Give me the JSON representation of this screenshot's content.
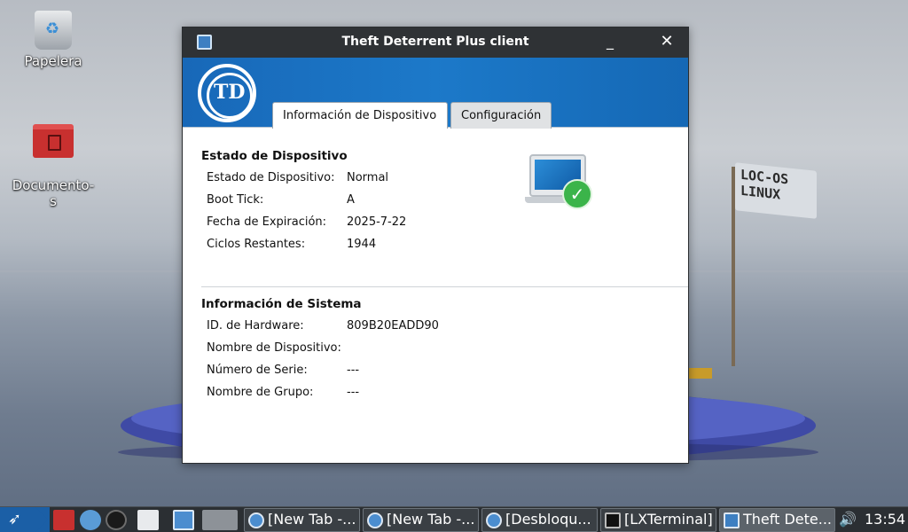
{
  "desktop": {
    "icons": [
      {
        "label": "Papelera",
        "icon": "trash-icon"
      },
      {
        "label": "Documento-\ns",
        "icon": "folder-icon"
      }
    ],
    "flag_text": [
      "LOC-OS",
      "LINUX"
    ]
  },
  "window": {
    "title": "Theft Deterrent Plus client",
    "minimize_glyph": "_",
    "close_glyph": "✕",
    "logo_text": "TD",
    "tabs": [
      {
        "label": "Información de Dispositivo",
        "active": true
      },
      {
        "label": "Configuración",
        "active": false
      }
    ],
    "device_status": {
      "heading": "Estado de Dispositivo",
      "rows": [
        {
          "label": "Estado de Dispositivo:",
          "value": "Normal"
        },
        {
          "label": "Boot Tick:",
          "value": "A"
        },
        {
          "label": "Fecha de Expiración:",
          "value": "2025-7-22"
        },
        {
          "label": "Ciclos Restantes:",
          "value": "1944"
        }
      ]
    },
    "system_info": {
      "heading": "Información de Sistema",
      "rows": [
        {
          "label": "ID. de Hardware:",
          "value": "809B20EADD90"
        },
        {
          "label": "Nombre de Dispositivo:",
          "value": ""
        },
        {
          "label": "Número de Serie:",
          "value": "---"
        },
        {
          "label": "Nombre de Grupo:",
          "value": "---"
        }
      ]
    },
    "status_icon": "laptop-check-icon"
  },
  "taskbar": {
    "tasks": [
      {
        "label": "[New Tab -...",
        "icon": "chromium-icon",
        "active": false
      },
      {
        "label": "[New Tab -...",
        "icon": "chromium-icon",
        "active": false
      },
      {
        "label": "[Desbloqu...",
        "icon": "chromium-icon",
        "active": false
      },
      {
        "label": "[LXTerminal]",
        "icon": "terminal-icon",
        "active": false
      },
      {
        "label": "Theft Dete...",
        "icon": "theft-deterrent-icon",
        "active": true
      }
    ],
    "clock": "13:54"
  },
  "colors": {
    "banner_blue": "#1c79c9",
    "titlebar": "#2f3235",
    "taskbar": "#2b2f33",
    "ok_green": "#3bb44a"
  }
}
